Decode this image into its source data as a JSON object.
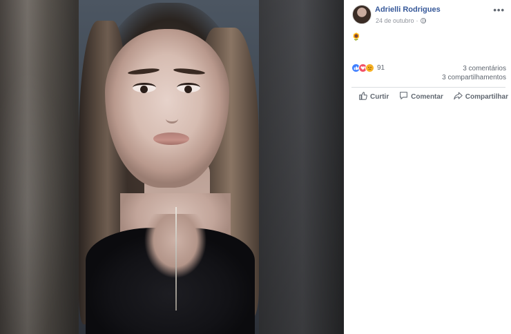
{
  "post": {
    "author_name": "Adrielli Rodrigues",
    "date": "24 de outubro",
    "separator": "·",
    "emoji_text": "🌻",
    "more_label": "•••"
  },
  "reactions": {
    "types": [
      "like",
      "love",
      "sad"
    ],
    "count": "91",
    "comments": "3 comentários",
    "shares": "3 compartilhamentos"
  },
  "actions": {
    "like_label": "Curtir",
    "comment_label": "Comentar",
    "share_label": "Compartilhar"
  },
  "colors": {
    "author_link": "#365899",
    "meta_gray": "#90949c",
    "like_blue": "#4080ff",
    "love_red": "#f25268",
    "sad_yellow": "#f7b125"
  },
  "icons": {
    "privacy": "globe-icon",
    "like_action": "thumbs-up-icon",
    "comment_action": "speech-bubble-icon",
    "share_action": "share-arrow-icon"
  }
}
